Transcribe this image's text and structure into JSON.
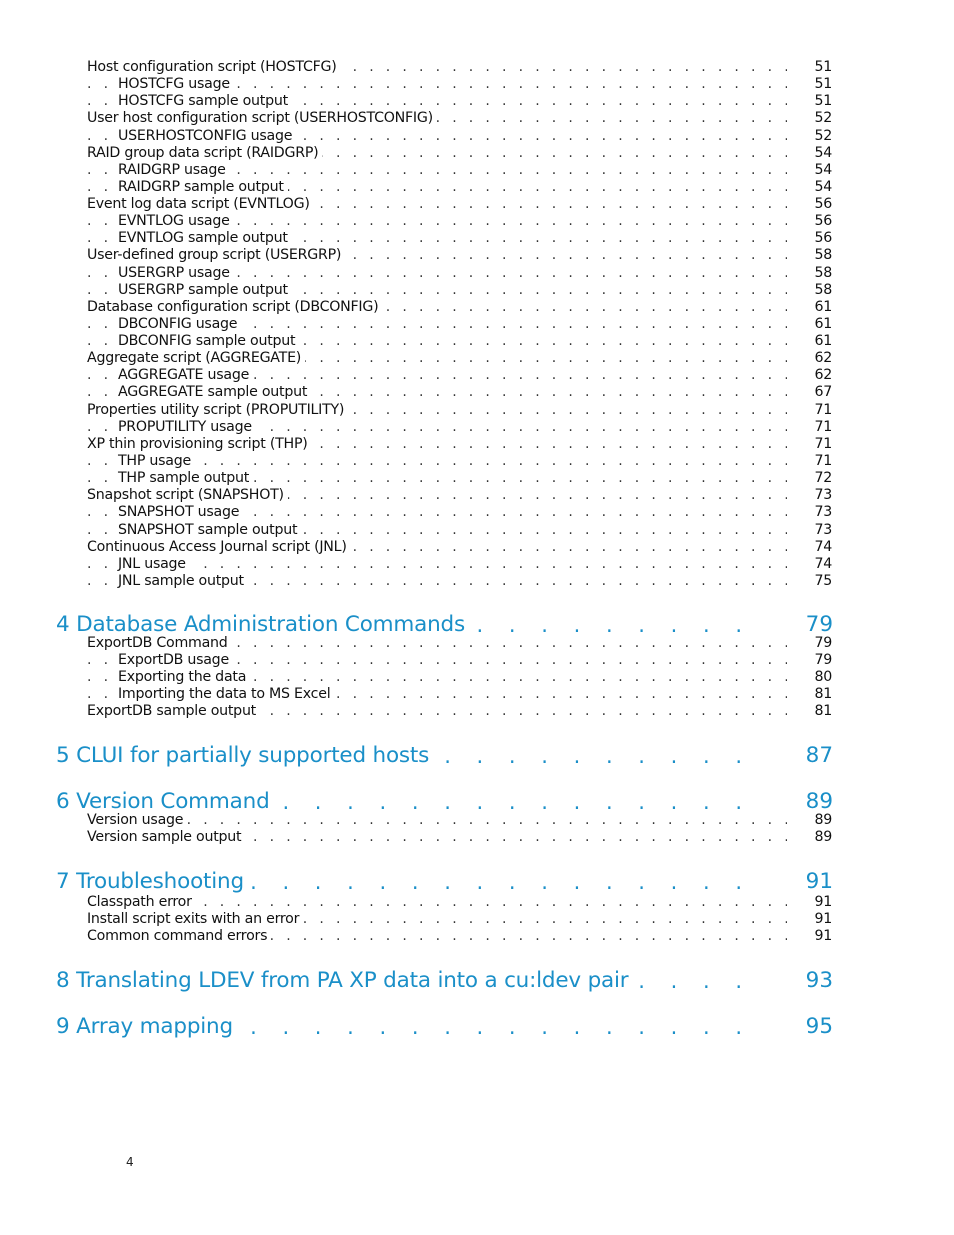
{
  "toc": [
    {
      "level": 1,
      "title": "Host configuration script (HOSTCFG)",
      "page": "51"
    },
    {
      "level": 2,
      "title": "HOSTCFG usage",
      "page": "51"
    },
    {
      "level": 2,
      "title": "HOSTCFG sample output",
      "page": "51"
    },
    {
      "level": 1,
      "title": "User host configuration script (USERHOSTCONFIG)",
      "page": "52"
    },
    {
      "level": 2,
      "title": "USERHOSTCONFIG usage",
      "page": "52"
    },
    {
      "level": 1,
      "title": "RAID group data script (RAIDGRP)",
      "page": "54"
    },
    {
      "level": 2,
      "title": "RAIDGRP usage",
      "page": "54"
    },
    {
      "level": 2,
      "title": "RAIDGRP sample output",
      "page": "54"
    },
    {
      "level": 1,
      "title": "Event log data script (EVNTLOG)",
      "page": "56"
    },
    {
      "level": 2,
      "title": "EVNTLOG usage",
      "page": "56"
    },
    {
      "level": 2,
      "title": "EVNTLOG sample output",
      "page": "56"
    },
    {
      "level": 1,
      "title": "User-defined group script (USERGRP)",
      "page": "58"
    },
    {
      "level": 2,
      "title": "USERGRP usage",
      "page": "58"
    },
    {
      "level": 2,
      "title": "USERGRP sample output",
      "page": "58"
    },
    {
      "level": 1,
      "title": "Database configuration script (DBCONFIG)",
      "page": "61"
    },
    {
      "level": 2,
      "title": "DBCONFIG usage",
      "page": "61"
    },
    {
      "level": 2,
      "title": "DBCONFIG sample output",
      "page": "61"
    },
    {
      "level": 1,
      "title": "Aggregate script (AGGREGATE)",
      "page": "62"
    },
    {
      "level": 2,
      "title": "AGGREGATE usage",
      "page": "62"
    },
    {
      "level": 2,
      "title": "AGGREGATE sample output",
      "page": "67"
    },
    {
      "level": 1,
      "title": "Properties utility script (PROPUTILITY)",
      "page": "71"
    },
    {
      "level": 2,
      "title": "PROPUTILITY usage",
      "page": "71"
    },
    {
      "level": 1,
      "title": "XP thin provisioning script (THP)",
      "page": "71"
    },
    {
      "level": 2,
      "title": "THP usage",
      "page": "71"
    },
    {
      "level": 2,
      "title": "THP sample output",
      "page": "72"
    },
    {
      "level": 1,
      "title": "Snapshot script (SNAPSHOT)",
      "page": "73"
    },
    {
      "level": 2,
      "title": "SNAPSHOT usage",
      "page": "73"
    },
    {
      "level": 2,
      "title": "SNAPSHOT sample output",
      "page": "73"
    },
    {
      "level": 1,
      "title": "Continuous Access Journal script (JNL)",
      "page": "74"
    },
    {
      "level": 2,
      "title": "JNL usage",
      "page": "74"
    },
    {
      "level": 2,
      "title": "JNL sample output",
      "page": "75"
    },
    {
      "level": 0,
      "title": "4 Database Administration Commands",
      "page": "79"
    },
    {
      "level": 1,
      "title": "ExportDB Command",
      "page": "79"
    },
    {
      "level": 2,
      "title": "ExportDB usage",
      "page": "79"
    },
    {
      "level": 2,
      "title": "Exporting the data",
      "page": "80"
    },
    {
      "level": 2,
      "title": "Importing the data to MS Excel",
      "page": "81"
    },
    {
      "level": 1,
      "title": "ExportDB sample output",
      "page": "81"
    },
    {
      "level": 0,
      "title": "5 CLUI for partially supported hosts",
      "page": "87"
    },
    {
      "level": 0,
      "title": "6 Version Command",
      "page": "89"
    },
    {
      "level": 1,
      "title": "Version usage",
      "page": "89"
    },
    {
      "level": 1,
      "title": "Version sample output",
      "page": "89"
    },
    {
      "level": 0,
      "title": "7 Troubleshooting",
      "page": "91"
    },
    {
      "level": 1,
      "title": "Classpath error",
      "page": "91"
    },
    {
      "level": 1,
      "title": "Install script exits with an error",
      "page": "91"
    },
    {
      "level": 1,
      "title": "Common command errors",
      "page": "91"
    },
    {
      "level": 0,
      "title": "8 Translating LDEV from PA XP data into a cu:ldev pair",
      "page": "93"
    },
    {
      "level": 0,
      "title": "9 Array mapping",
      "page": "95"
    }
  ],
  "folio": "4",
  "colors": {
    "chapter": "#1a8fc8",
    "text": "#111111"
  }
}
